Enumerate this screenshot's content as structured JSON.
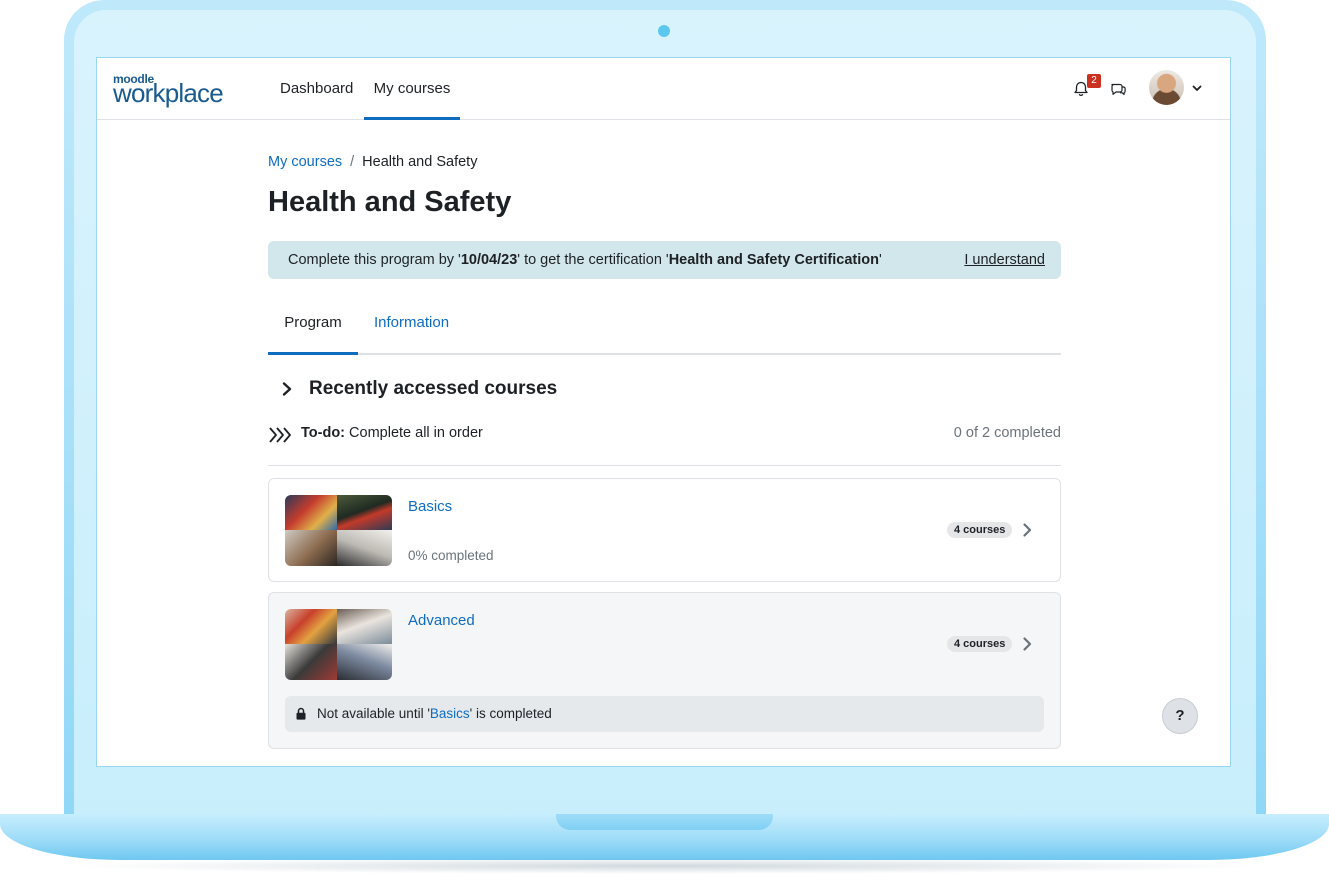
{
  "app": {
    "logo_small": "moodle",
    "logo_big": "workplace"
  },
  "nav": {
    "items": [
      {
        "label": "Dashboard"
      },
      {
        "label": "My courses",
        "active": true
      }
    ],
    "notifications_count": "2"
  },
  "breadcrumb": {
    "parent": "My courses",
    "separator": "/",
    "current": "Health and Safety"
  },
  "page": {
    "title": "Health and Safety"
  },
  "alert": {
    "prefix": "Complete this program by '",
    "date": "10/04/23",
    "middle": "' to get the certification '",
    "certification": "Health and Safety Certification",
    "suffix": "'",
    "dismiss_label": "I understand"
  },
  "tabs": [
    {
      "label": "Program",
      "active": true
    },
    {
      "label": "Information",
      "active": false
    }
  ],
  "section": {
    "title": "Recently accessed courses"
  },
  "todo": {
    "label": "To-do:",
    "text": "Complete all in order",
    "progress": "0 of 2 completed"
  },
  "cards": [
    {
      "name": "Basics",
      "progress_text": "0% completed",
      "courses_label": "4 courses"
    },
    {
      "name": "Advanced",
      "courses_label": "4 courses",
      "restriction": {
        "prefix": "Not available until '",
        "link": "Basics",
        "suffix": "' is completed"
      }
    }
  ],
  "help": {
    "label": "?"
  },
  "colors": {
    "accent": "#0f6cbf",
    "alert_bg": "#d2e7ec",
    "badge": "#ca3120",
    "frame": "#aee2fa"
  }
}
